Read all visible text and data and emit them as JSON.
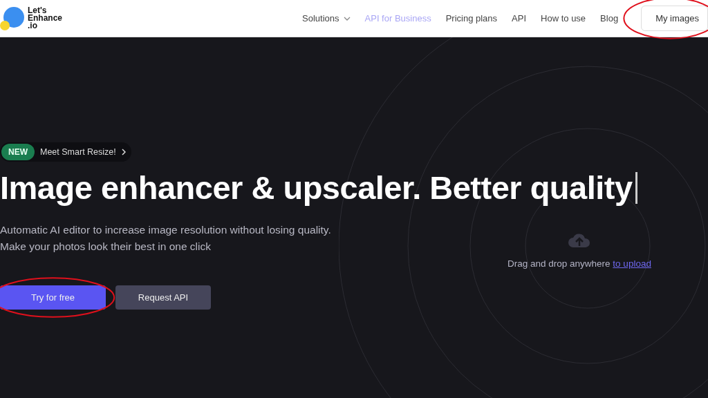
{
  "logo": {
    "lines": [
      "Let's",
      "Enhance",
      ".io"
    ]
  },
  "nav": {
    "items": [
      {
        "label": "Solutions",
        "kind": "dropdown",
        "selected": false
      },
      {
        "label": "API for Business",
        "kind": "link",
        "selected": true
      },
      {
        "label": "Pricing plans",
        "kind": "link",
        "selected": false
      },
      {
        "label": "API",
        "kind": "link",
        "selected": false
      },
      {
        "label": "How to use",
        "kind": "link",
        "selected": false
      },
      {
        "label": "Blog",
        "kind": "link",
        "selected": false
      }
    ],
    "account_button": {
      "label": "My images",
      "circled": true
    }
  },
  "hero": {
    "badge": {
      "tag": "NEW",
      "text": "Meet Smart Resize!"
    },
    "headline": "Image enhancer & upscaler. Better quality",
    "description": [
      "Automatic AI editor to increase image resolution without losing quality.",
      "Make your photos look their best in one click"
    ],
    "buttons": [
      {
        "label": "Try for free",
        "kind": "primary",
        "circled": true
      },
      {
        "label": "Request API",
        "kind": "secondary",
        "circled": false
      }
    ]
  },
  "upload": {
    "text": "Drag and drop anywhere",
    "link": "to upload"
  }
}
